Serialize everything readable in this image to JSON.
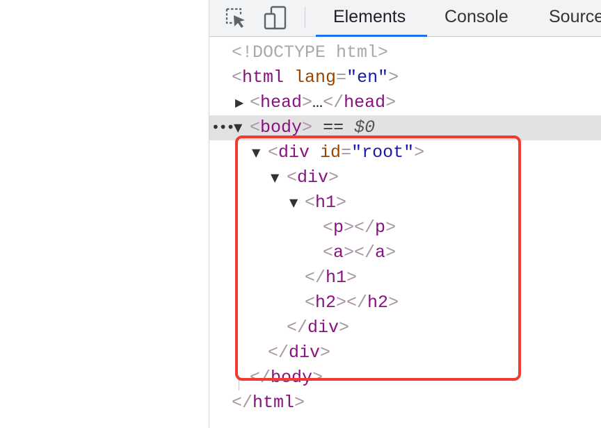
{
  "toolbar": {
    "icons": [
      "inspect-element-icon",
      "device-toolbar-icon"
    ],
    "tabs": [
      {
        "label": "Elements",
        "active": true
      },
      {
        "label": "Console",
        "active": false
      },
      {
        "label": "Source",
        "active": false
      }
    ]
  },
  "dom_tree": {
    "doctype": "<!DOCTYPE html>",
    "html_open": {
      "tag": "html",
      "attr": "lang",
      "value": "\"en\""
    },
    "head": {
      "tag": "head",
      "ellipsis": "…"
    },
    "body": {
      "tag": "body",
      "eq": "==",
      "ref": "$0"
    },
    "div_root": {
      "tag": "div",
      "attr": "id",
      "value": "\"root\""
    },
    "div": {
      "tag": "div"
    },
    "h1": {
      "tag": "h1"
    },
    "p": {
      "tag": "p"
    },
    "a": {
      "tag": "a"
    },
    "h2": {
      "tag": "h2"
    },
    "html_close": {
      "tag": "html"
    }
  },
  "colors": {
    "highlight_box": "#f23a2e",
    "tag": "#881280",
    "attribute": "#994500",
    "value": "#1a1aa6",
    "active_tab_underline": "#1a73e8"
  }
}
